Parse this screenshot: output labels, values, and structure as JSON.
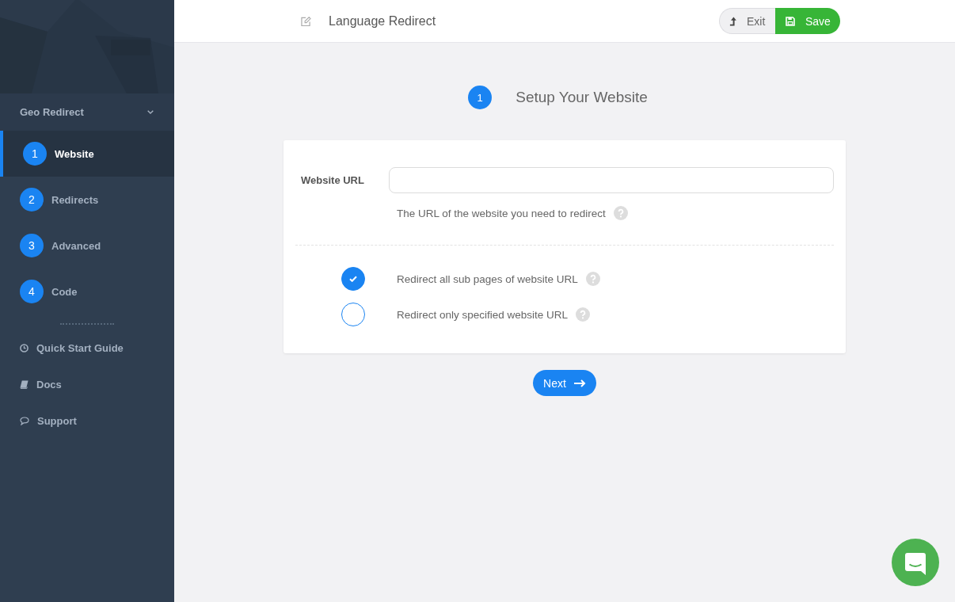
{
  "sidebar": {
    "section": {
      "label": "Geo Redirect",
      "expanded": true
    },
    "steps": [
      {
        "number": "1",
        "label": "Website",
        "selected": true
      },
      {
        "number": "2",
        "label": "Redirects",
        "selected": false
      },
      {
        "number": "3",
        "label": "Advanced",
        "selected": false
      },
      {
        "number": "4",
        "label": "Code",
        "selected": false
      }
    ],
    "links": [
      {
        "label": "Quick Start Guide"
      },
      {
        "label": "Docs"
      },
      {
        "label": "Support"
      }
    ]
  },
  "header": {
    "title": "Language Redirect",
    "buttons": [
      {
        "kind": "exit",
        "label": "Exit"
      },
      {
        "kind": "save",
        "label": "Save"
      }
    ]
  },
  "step_header": {
    "number": "1",
    "title": "Setup Your Website"
  },
  "form": {
    "url_field": {
      "label": "Website URL",
      "help": "The URL of the website you need to redirect"
    },
    "options": [
      {
        "label": "Redirect all sub pages of website URL",
        "selected": true
      },
      {
        "label": "Redirect only specified website URL",
        "selected": false
      }
    ]
  },
  "next_button": {
    "label": "Next"
  }
}
